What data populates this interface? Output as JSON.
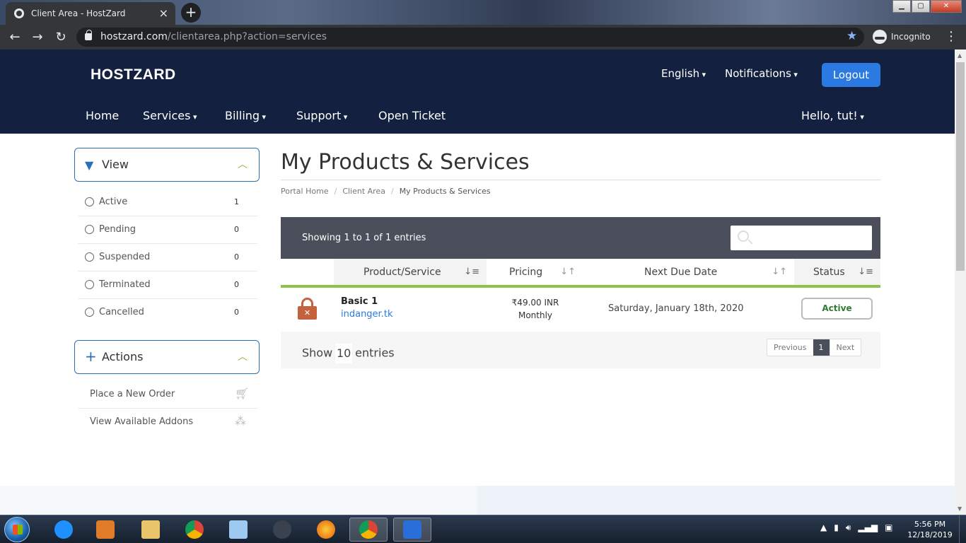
{
  "browser": {
    "tab_title": "Client Area - HostZard",
    "tab_close": "×",
    "new_tab": "+",
    "url_host": "hostzard.com",
    "url_path": "/clientarea.php?action=services",
    "incognito_label": "Incognito"
  },
  "header": {
    "logo": "HOSTZARD",
    "language": "English",
    "notifications": "Notifications",
    "logout": "Logout"
  },
  "nav": {
    "home": "Home",
    "services": "Services",
    "billing": "Billing",
    "support": "Support",
    "open_ticket": "Open Ticket",
    "user_greeting": "Hello, tut!"
  },
  "sidebar": {
    "view_title": "View",
    "filters": [
      {
        "label": "Active",
        "count": "1"
      },
      {
        "label": "Pending",
        "count": "0"
      },
      {
        "label": "Suspended",
        "count": "0"
      },
      {
        "label": "Terminated",
        "count": "0"
      },
      {
        "label": "Cancelled",
        "count": "0"
      }
    ],
    "actions_title": "Actions",
    "actions": [
      {
        "label": "Place a New Order",
        "icon": "cart-icon"
      },
      {
        "label": "View Available Addons",
        "icon": "cubes-icon"
      }
    ]
  },
  "main": {
    "title": "My Products & Services",
    "breadcrumb": [
      "Portal Home",
      "Client Area",
      "My Products & Services"
    ],
    "showing": "Showing 1 to 1 of 1 entries",
    "columns": [
      "Product/Service",
      "Pricing",
      "Next Due Date",
      "Status"
    ],
    "rows": [
      {
        "name": "Basic 1",
        "domain": "indanger.tk",
        "price": "₹49.00 INR",
        "cycle": "Monthly",
        "due": "Saturday, January 18th, 2020",
        "status": "Active"
      }
    ],
    "show_label": "Show",
    "show_value": "10",
    "entries_label": "entries",
    "pager": {
      "previous": "Previous",
      "current": "1",
      "next": "Next"
    }
  },
  "taskbar": {
    "time": "5:56 PM",
    "date": "12/18/2019"
  },
  "colors": {
    "header_bg": "#13203f",
    "accent_blue": "#2a7ae2",
    "green_rule": "#8fc24a",
    "status_green": "#2e7d32",
    "lock_orange": "#c4623d"
  }
}
